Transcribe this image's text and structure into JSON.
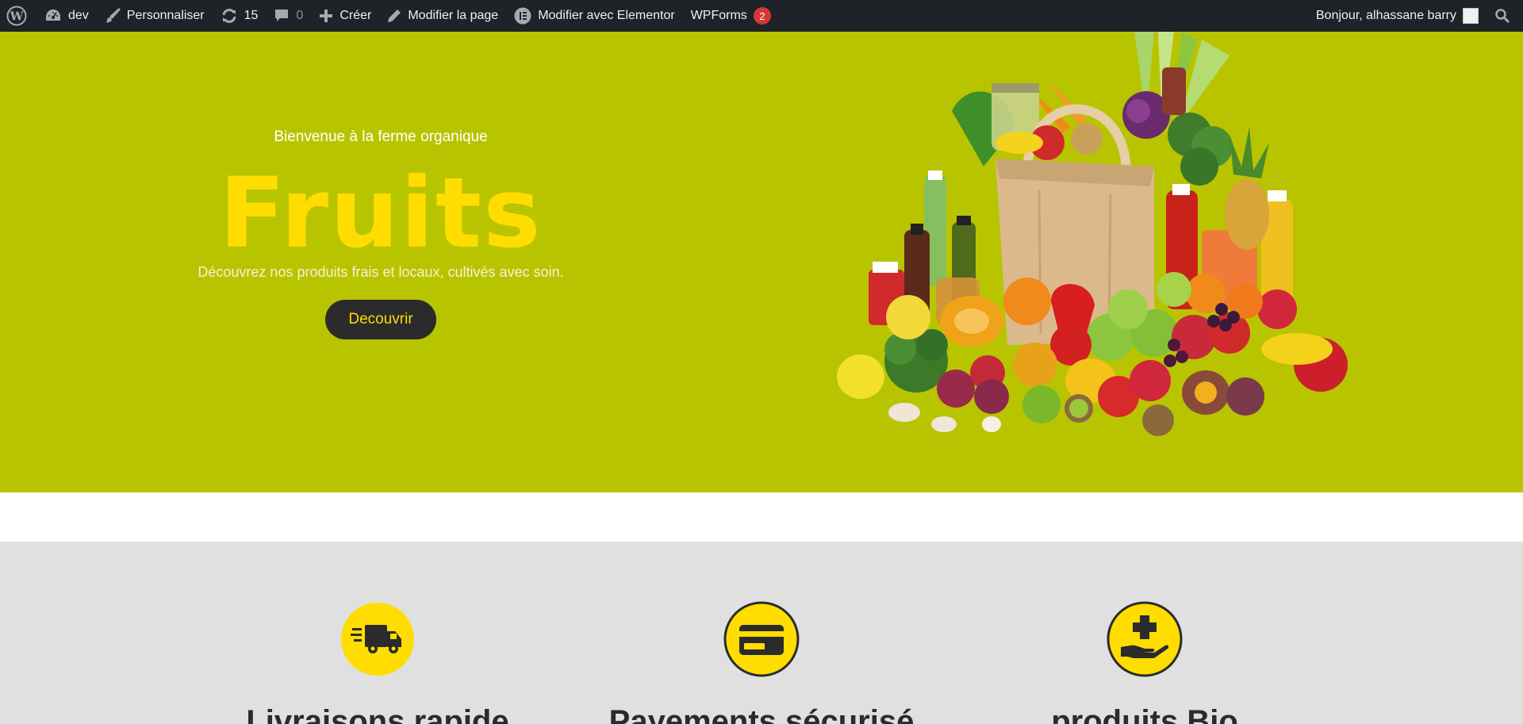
{
  "adminbar": {
    "site_name": "dev",
    "customize": "Personnaliser",
    "updates_count": "15",
    "comments_count": "0",
    "new": "Créer",
    "edit_page": "Modifier la page",
    "elementor": "Modifier avec Elementor",
    "wpforms": "WPForms",
    "wpforms_badge": "2",
    "greeting": "Bonjour, alhassane barry",
    "icons": [
      "wordpress-icon",
      "dashboard-icon",
      "brush-icon",
      "updates-icon",
      "comment-icon",
      "plus-icon",
      "pencil-icon",
      "elementor-icon",
      "search-icon"
    ]
  },
  "hero": {
    "kicker": "Bienvenue à la ferme organique",
    "title": "Fruits",
    "subtitle": "Découvrez nos produits frais et locaux, cultivés avec soin.",
    "button": "Decouvrir",
    "background_color": "#b9c400",
    "title_color": "#ffdd00"
  },
  "features": {
    "items": [
      {
        "title": "Livraisons rapide",
        "icon": "truck-icon"
      },
      {
        "title": "Payements sécurisé",
        "icon": "credit-card-icon"
      },
      {
        "title": "produits Bio",
        "icon": "hand-plus-icon"
      }
    ],
    "icon_color": "#ffdd00"
  }
}
